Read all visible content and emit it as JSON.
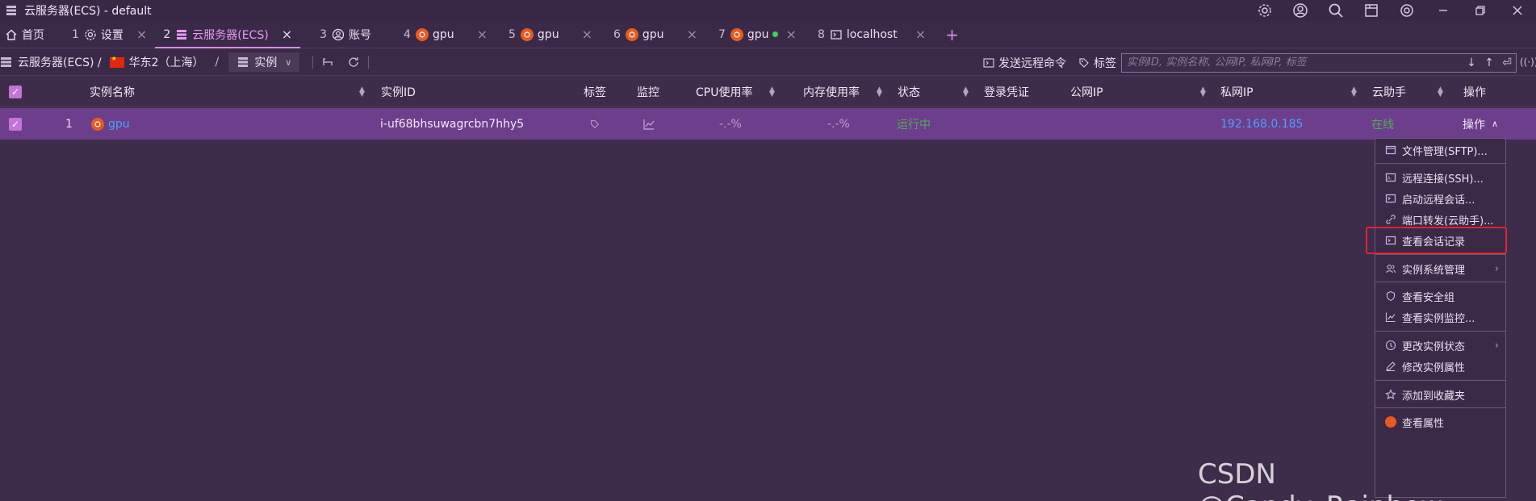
{
  "window": {
    "title": "云服务器(ECS) - default"
  },
  "tabs": [
    {
      "num": "",
      "label": "首页",
      "icon": "home-icon"
    },
    {
      "num": "1",
      "label": "设置",
      "icon": "gear-icon"
    },
    {
      "num": "2",
      "label": "云服务器(ECS)",
      "icon": "server-icon",
      "active": true
    },
    {
      "num": "3",
      "label": "账号",
      "icon": "user-icon"
    },
    {
      "num": "4",
      "label": "gpu",
      "icon": "ubuntu-icon"
    },
    {
      "num": "5",
      "label": "gpu",
      "icon": "ubuntu-icon"
    },
    {
      "num": "6",
      "label": "gpu",
      "icon": "ubuntu-icon"
    },
    {
      "num": "7",
      "label": "gpu",
      "icon": "ubuntu-icon",
      "online_dot": true
    },
    {
      "num": "8",
      "label": "localhost",
      "icon": "terminal-icon"
    }
  ],
  "breadcrumb": {
    "service": "云服务器(ECS) /",
    "region": "华东2（上海）",
    "sep": "/",
    "view": "实例"
  },
  "toolbar": {
    "send_command": "发送远程命令",
    "tags": "标签",
    "search_placeholder": "实例ID, 实例名称, 公网IP, 私网IP, 标签"
  },
  "table": {
    "headers": {
      "name": "实例名称",
      "id": "实例ID",
      "tags": "标签",
      "monitor": "监控",
      "cpu": "CPU使用率",
      "mem": "内存使用率",
      "status": "状态",
      "login": "登录凭证",
      "public_ip": "公网IP",
      "private_ip": "私网IP",
      "assistant": "云助手",
      "ops": "操作"
    },
    "rows": [
      {
        "index": "1",
        "name": "gpu",
        "id": "i-uf68bhsuwagrcbn7hhy5",
        "cpu": "-.-%",
        "mem": "-.-%",
        "status": "运行中",
        "public_ip": "",
        "private_ip": "192.168.0.185",
        "assistant": "在线",
        "ops": "操作"
      }
    ]
  },
  "menu": {
    "items": [
      {
        "label": "文件管理(SFTP)...",
        "icon": "folder-icon"
      },
      {
        "label": "远程连接(SSH)...",
        "icon": "ssh-icon"
      },
      {
        "label": "启动远程会话...",
        "icon": "terminal-icon"
      },
      {
        "label": "端口转发(云助手)...",
        "icon": "link-icon"
      },
      {
        "label": "查看会话记录",
        "icon": "terminal-icon"
      },
      {
        "label": "实例系统管理",
        "icon": "users-icon"
      },
      {
        "label": "查看安全组",
        "icon": "shield-icon"
      },
      {
        "label": "查看实例监控...",
        "icon": "chart-icon"
      },
      {
        "label": "更改实例状态",
        "icon": "clock-icon"
      },
      {
        "label": "修改实例属性",
        "icon": "pencil-icon"
      },
      {
        "label": "添加到收藏夹",
        "icon": "star-icon"
      },
      {
        "label": "查看属性",
        "icon": "ubuntu-icon"
      }
    ]
  },
  "watermark": "CSDN @Candy_Rainbow_",
  "colors": {
    "background": "#3d2d4b",
    "selected_row": "#6d3e8c",
    "accent": "#d78ae6",
    "link": "#4aa3ff",
    "running": "#4caf50",
    "highlight_box": "#e5242b"
  }
}
